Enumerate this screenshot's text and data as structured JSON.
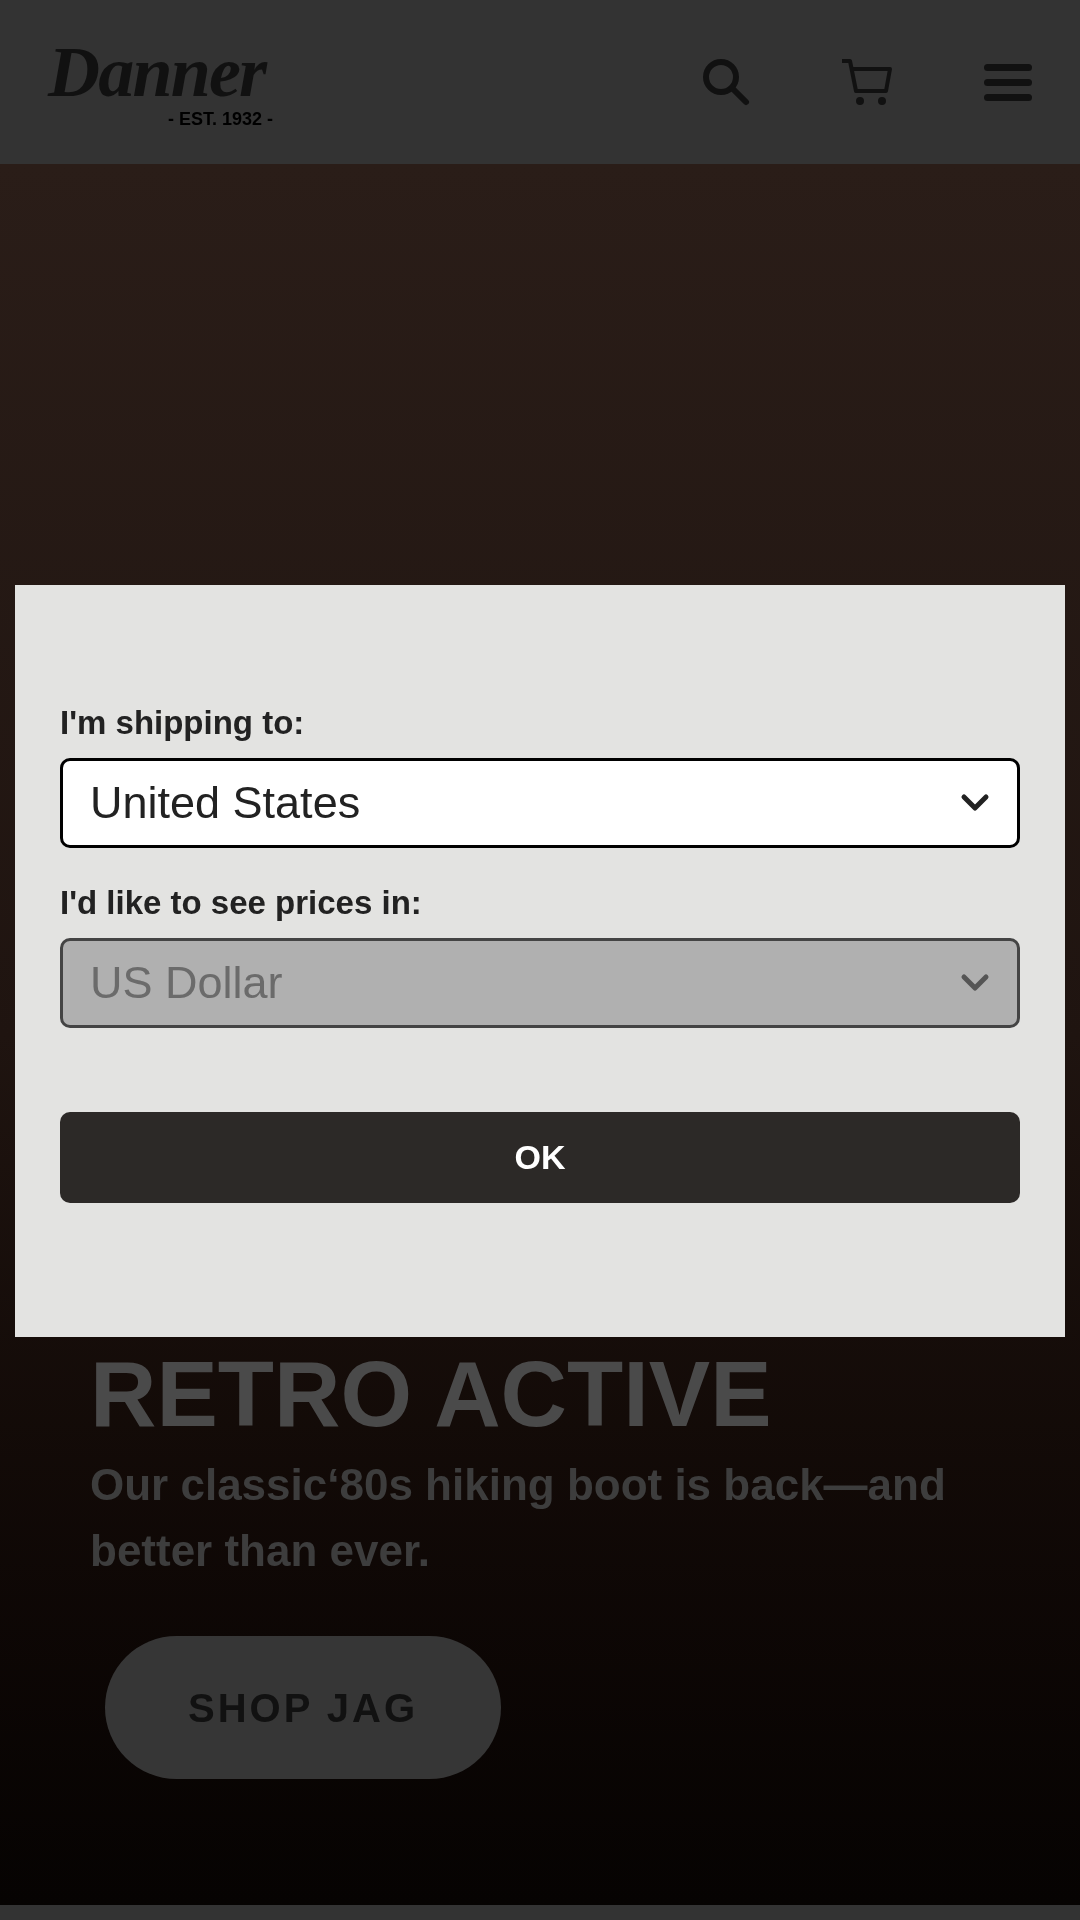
{
  "header": {
    "logo": {
      "wordmark": "Danner",
      "tagline": "- EST. 1932 -"
    }
  },
  "hero": {
    "headline": "RETRO ACTIVE",
    "subtitle": "Our classic‘80s hiking boot is back—and better than ever.",
    "button": "SHOP JAG"
  },
  "dialog": {
    "fields": [
      {
        "label": "I'm shipping to:",
        "value": "United States",
        "disabled": false
      },
      {
        "label": "I'd like to see prices in:",
        "value": "US Dollar",
        "disabled": true
      }
    ],
    "button": "OK"
  }
}
